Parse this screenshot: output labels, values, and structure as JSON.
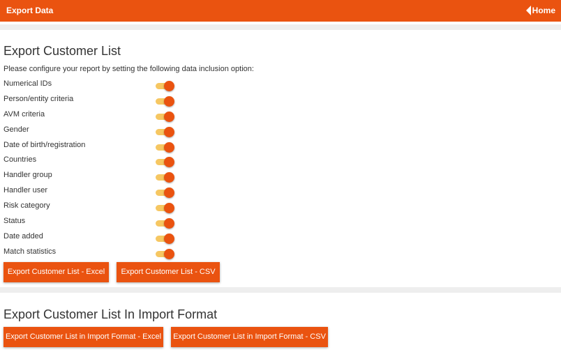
{
  "header": {
    "title": "Export Data",
    "home_label": "Home"
  },
  "section1": {
    "title": "Export Customer List",
    "description": "Please configure your report by setting the following data inclusion option:",
    "options": [
      {
        "label": "Numerical IDs",
        "enabled": true
      },
      {
        "label": "Person/entity criteria",
        "enabled": true
      },
      {
        "label": "AVM criteria",
        "enabled": true
      },
      {
        "label": "Gender",
        "enabled": true
      },
      {
        "label": "Date of birth/registration",
        "enabled": true
      },
      {
        "label": "Countries",
        "enabled": true
      },
      {
        "label": "Handler group",
        "enabled": true
      },
      {
        "label": "Handler user",
        "enabled": true
      },
      {
        "label": "Risk category",
        "enabled": true
      },
      {
        "label": "Status",
        "enabled": true
      },
      {
        "label": "Date added",
        "enabled": true
      },
      {
        "label": "Match statistics",
        "enabled": true
      }
    ],
    "buttons": {
      "excel": "Export Customer List - Excel",
      "csv": "Export Customer List - CSV"
    }
  },
  "section2": {
    "title": "Export Customer List In Import Format",
    "buttons": {
      "excel": "Export Customer List in Import Format - Excel",
      "csv": "Export Customer List in Import Format - CSV"
    }
  },
  "colors": {
    "accent": "#ea5310",
    "toggle_track": "#f6c762",
    "separator": "#eeeeee"
  },
  "icons": {
    "home": "caret-left-icon"
  }
}
